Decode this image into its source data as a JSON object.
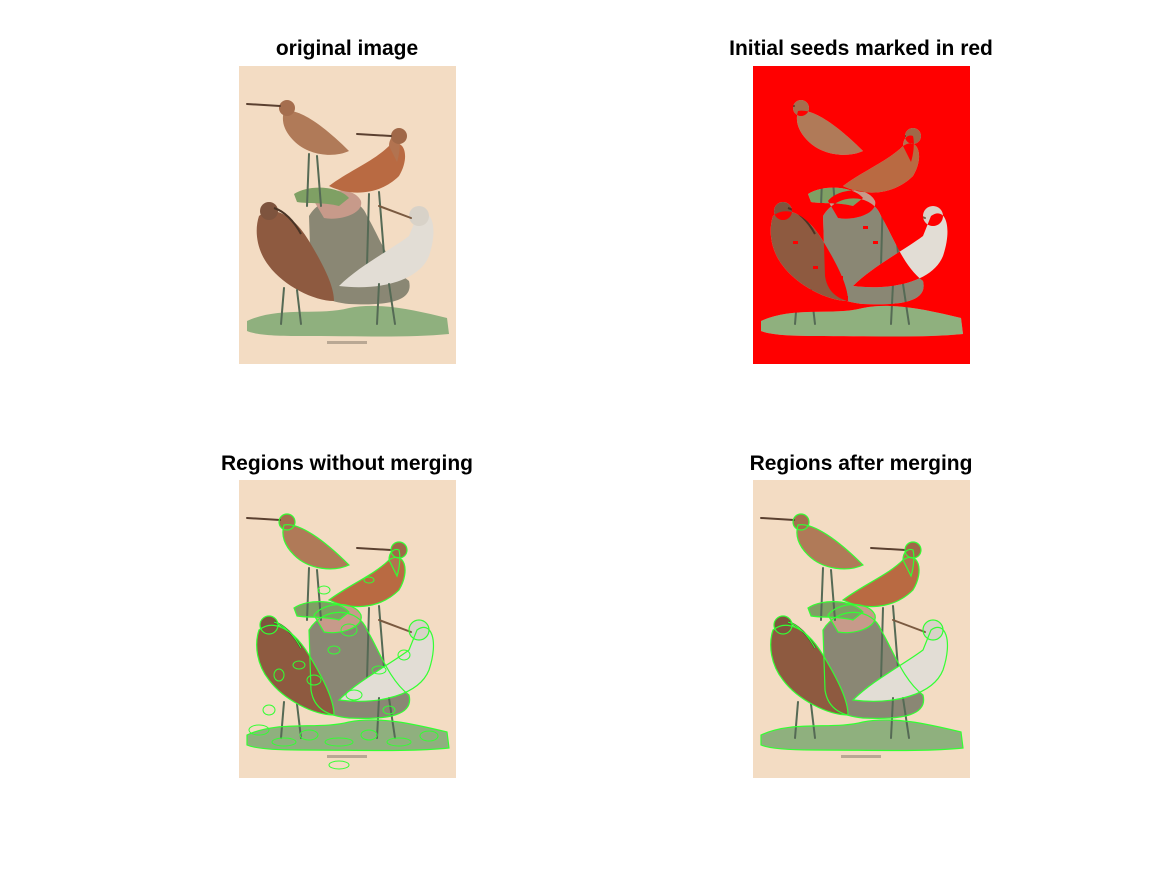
{
  "figure": {
    "panels": [
      {
        "title": "original image",
        "variant": "original"
      },
      {
        "title": "Initial seeds marked in red",
        "variant": "seeds"
      },
      {
        "title": "Regions without merging",
        "variant": "regions_unmerged"
      },
      {
        "title": "Regions after merging",
        "variant": "regions_merged"
      }
    ],
    "colors": {
      "paper": "#f3dcc3",
      "seed_red": "#ff0000",
      "contour_green": "#33ff33"
    }
  }
}
